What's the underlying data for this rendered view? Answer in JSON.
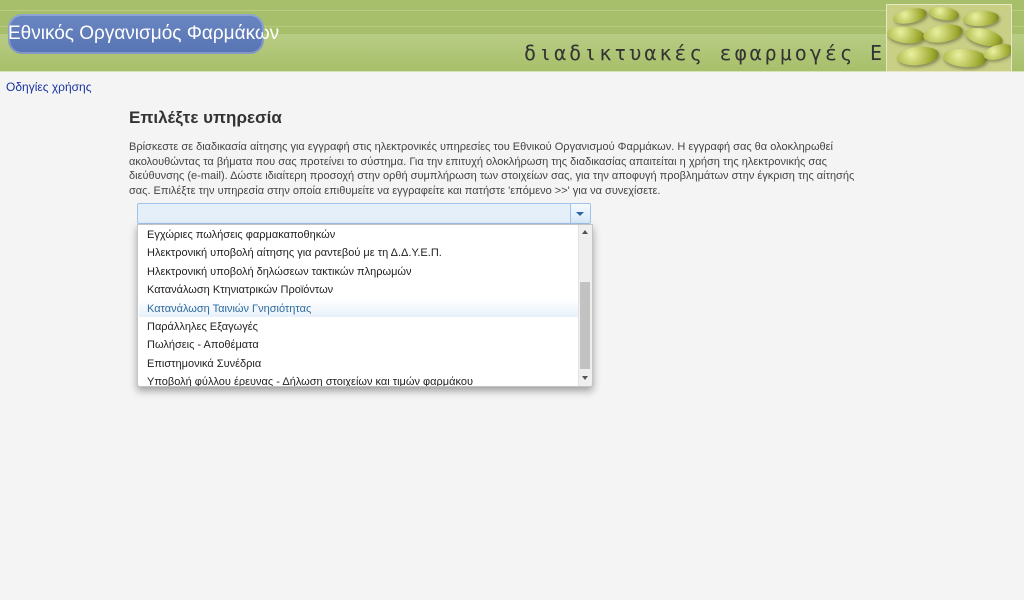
{
  "header": {
    "logo_text": "Εθνικός Οργανισμός Φαρμάκων",
    "subtitle": "διαδικτυακές εφαρμογές ΕΟΦ",
    "image_name": "pills-image"
  },
  "nav": {
    "help_link": "Οδηγίες χρήσης"
  },
  "main": {
    "title": "Επιλέξτε υπηρεσία",
    "intro": "Βρίσκεστε σε διαδικασία αίτησης για εγγραφή στις ηλεκτρονικές υπηρεσίες του Εθνικού Οργανισμού Φαρμάκων. Η εγγραφή σας θα ολοκληρωθεί ακολουθώντας τα βήματα που σας προτείνει το σύστημα. Για την επιτυχή ολοκλήρωση της διαδικασίας απαιτείται η χρήση της ηλεκτρονικής σας διεύθυνσης (e-mail). Δώστε ιδιαίτερη προσοχή στην ορθή συμπλήρωση των στοιχείων σας, για την αποφυγή προβλημάτων στην έγκριση της αίτησής σας. Επιλέξτε την υπηρεσία στην οποία επιθυμείτε να εγγραφείτε και πατήστε 'επόμενο >>' για να συνεχίσετε."
  },
  "dropdown": {
    "selected_value": "",
    "highlighted_index": 4,
    "options": [
      "Εγχώριες πωλήσεις φαρμακαποθηκών",
      "Ηλεκτρονική υποβολή αίτησης για ραντεβού με τη Δ.Δ.Υ.Ε.Π.",
      "Ηλεκτρονική υποβολή δηλώσεων τακτικών πληρωμών",
      "Κατανάλωση Κτηνιατρικών Προϊόντων",
      "Κατανάλωση Ταινιών Γνησιότητας",
      "Παράλληλες Εξαγωγές",
      "Πωλήσεις - Αποθέματα",
      "Επιστημονικά Συνέδρια",
      "Υποβολή φύλλου έρευνας - Δήλωση στοιχείων και τιμών φαρμάκου"
    ]
  },
  "colors": {
    "header_green": "#a7bf6a",
    "logo_blue": "#5774b3",
    "link_blue": "#1a33a3",
    "highlight_text": "#2e6b9e"
  }
}
